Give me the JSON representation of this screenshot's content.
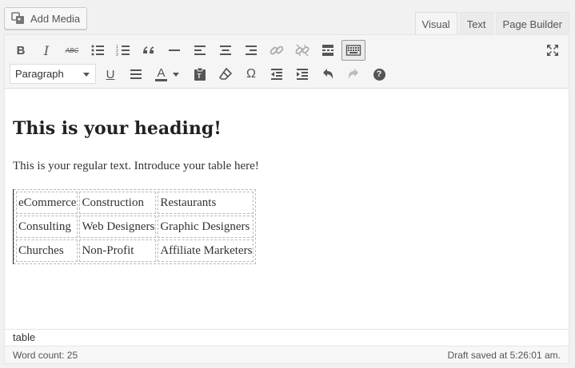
{
  "media": {
    "add_media_label": "Add Media"
  },
  "tabs": [
    {
      "label": "Visual",
      "active": true
    },
    {
      "label": "Text",
      "active": false
    },
    {
      "label": "Page Builder",
      "active": false
    }
  ],
  "toolbar": {
    "format_select_value": "Paragraph",
    "row1_icons": [
      "bold-icon",
      "italic-icon",
      "strikethrough-icon",
      "bullet-list-icon",
      "numbered-list-icon",
      "blockquote-icon",
      "horizontal-line-icon",
      "align-left-icon",
      "align-center-icon",
      "align-right-icon",
      "insert-link-icon",
      "remove-link-icon",
      "read-more-icon",
      "toolbar-toggle-icon",
      "fullscreen-icon"
    ],
    "row2_icons": [
      "underline-icon",
      "justify-icon",
      "text-color-icon",
      "paste-as-text-icon",
      "clear-formatting-icon",
      "special-character-icon",
      "decrease-indent-icon",
      "increase-indent-icon",
      "undo-icon",
      "redo-icon",
      "help-icon"
    ],
    "bold_glyph": "B",
    "italic_glyph": "I",
    "strikethrough_glyph": "ABC",
    "underline_glyph": "U",
    "text_color_glyph": "A",
    "special_char_glyph": "Ω",
    "help_glyph": "?"
  },
  "content": {
    "heading": "This is your heading!",
    "paragraph": "This is your regular text. Introduce your table here!",
    "table": [
      [
        "eCommerce",
        "Construction",
        "Restaurants"
      ],
      [
        "Consulting",
        "Web Designers",
        "Graphic Designers"
      ],
      [
        "Churches",
        "Non-Profit",
        "Affiliate Marketers"
      ]
    ]
  },
  "path": "table",
  "status": {
    "word_count": "Word count: 25",
    "draft_saved": "Draft saved at 5:26:01 am."
  }
}
